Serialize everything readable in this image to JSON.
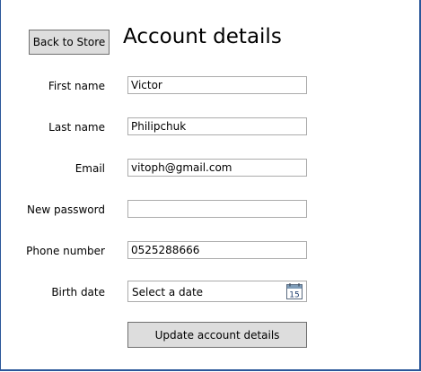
{
  "header": {
    "back_button_label": "Back to Store",
    "title": "Account details"
  },
  "form": {
    "first_name": {
      "label": "First name",
      "value": "Victor"
    },
    "last_name": {
      "label": "Last name",
      "value": "Philipchuk"
    },
    "email": {
      "label": "Email",
      "value": "vitoph@gmail.com"
    },
    "new_password": {
      "label": "New password",
      "value": ""
    },
    "phone_number": {
      "label": "Phone number",
      "value": "0525288666"
    },
    "birth_date": {
      "label": "Birth date",
      "placeholder": "Select a date",
      "icon": "calendar-icon",
      "icon_text": "15"
    },
    "submit_label": "Update account details"
  },
  "colors": {
    "window_border": "#2b579a",
    "button_bg": "#dddddd",
    "button_border": "#707070",
    "input_border": "#ababab"
  }
}
